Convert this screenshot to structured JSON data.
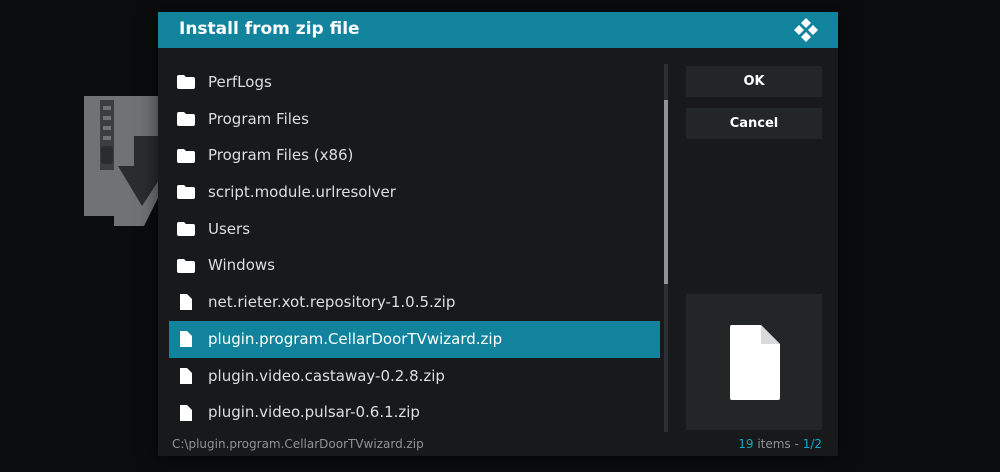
{
  "colors": {
    "accent": "#12839d",
    "panel": "#17191a",
    "button": "#232627",
    "muted_text": "#8f9496",
    "count_highlight": "#12a7c8"
  },
  "dialog": {
    "title": "Install from zip file",
    "logo_icon": "kodi-logo-icon"
  },
  "file_list": {
    "items": [
      {
        "label": "PerfLogs",
        "icon": "folder-icon",
        "selected": false
      },
      {
        "label": "Program Files",
        "icon": "folder-icon",
        "selected": false
      },
      {
        "label": "Program Files (x86)",
        "icon": "folder-icon",
        "selected": false
      },
      {
        "label": "script.module.urlresolver",
        "icon": "folder-icon",
        "selected": false
      },
      {
        "label": "Users",
        "icon": "folder-icon",
        "selected": false
      },
      {
        "label": "Windows",
        "icon": "folder-icon",
        "selected": false
      },
      {
        "label": "net.rieter.xot.repository-1.0.5.zip",
        "icon": "file-icon",
        "selected": false
      },
      {
        "label": "plugin.program.CellarDoorTVwizard.zip",
        "icon": "file-icon",
        "selected": true
      },
      {
        "label": "plugin.video.castaway-0.2.8.zip",
        "icon": "file-icon",
        "selected": false
      },
      {
        "label": "plugin.video.pulsar-0.6.1.zip",
        "icon": "file-icon",
        "selected": false
      }
    ]
  },
  "buttons": {
    "ok_label": "OK",
    "cancel_label": "Cancel"
  },
  "preview": {
    "icon": "file-icon"
  },
  "footer": {
    "path": "C:\\plugin.program.CellarDoorTVwizard.zip",
    "items_count": "19",
    "items_word": "items",
    "separator": "-",
    "page": "1/2"
  }
}
